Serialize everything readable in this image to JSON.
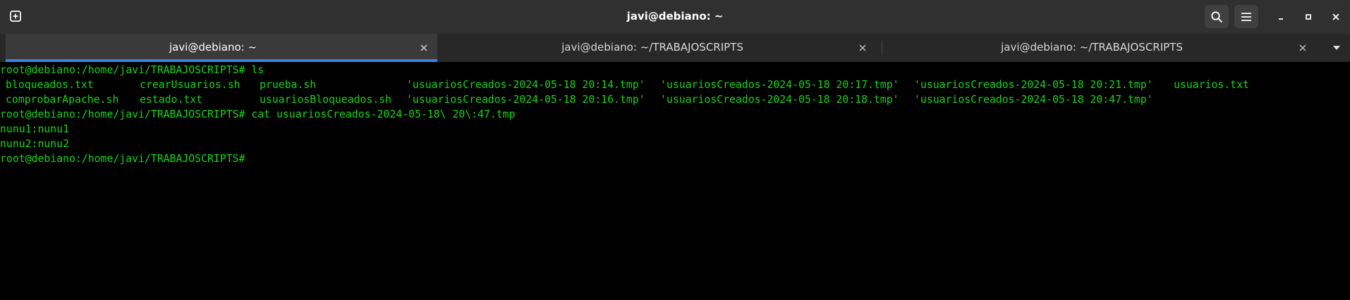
{
  "window": {
    "title": "javi@debiano: ~"
  },
  "header": {
    "icons": {
      "new_tab": "new-tab-icon",
      "search": "search-icon",
      "menu": "hamburger-menu-icon",
      "minimize": "minimize-icon",
      "maximize": "maximize-icon",
      "close": "close-icon"
    }
  },
  "tabs": [
    {
      "label": "javi@debiano: ~",
      "active": true
    },
    {
      "label": "javi@debiano: ~/TRABAJOSCRIPTS",
      "active": false
    },
    {
      "label": "javi@debiano: ~/TRABAJOSCRIPTS",
      "active": false
    }
  ],
  "colors": {
    "terminal_text": "#18d418",
    "terminal_bg": "#000000",
    "accent": "#3584e4",
    "headerbar_bg": "#303030"
  },
  "terminal": {
    "lines": {
      "cmd_ls": "root@debiano:/home/javi/TRABAJOSCRIPTS# ls",
      "cmd_cat": "root@debiano:/home/javi/TRABAJOSCRIPTS# cat usuariosCreados-2024-05-18\\ 20\\:47.tmp",
      "out_1": "nunu1:nunu1",
      "out_2": "nunu2:nunu2",
      "prompt": "root@debiano:/home/javi/TRABAJOSCRIPTS#"
    },
    "ls_rows": [
      [
        "bloqueados.txt",
        "crearUsuarios.sh",
        "prueba.sh",
        "'usuariosCreados-2024-05-18 20:14.tmp'",
        "'usuariosCreados-2024-05-18 20:17.tmp'",
        "'usuariosCreados-2024-05-18 20:21.tmp'",
        "usuarios.txt"
      ],
      [
        "comprobarApache.sh",
        "estado.txt",
        "usuariosBloqueados.sh",
        "'usuariosCreados-2024-05-18 20:16.tmp'",
        "'usuariosCreados-2024-05-18 20:18.tmp'",
        "'usuariosCreados-2024-05-18 20:47.tmp'",
        ""
      ]
    ]
  }
}
